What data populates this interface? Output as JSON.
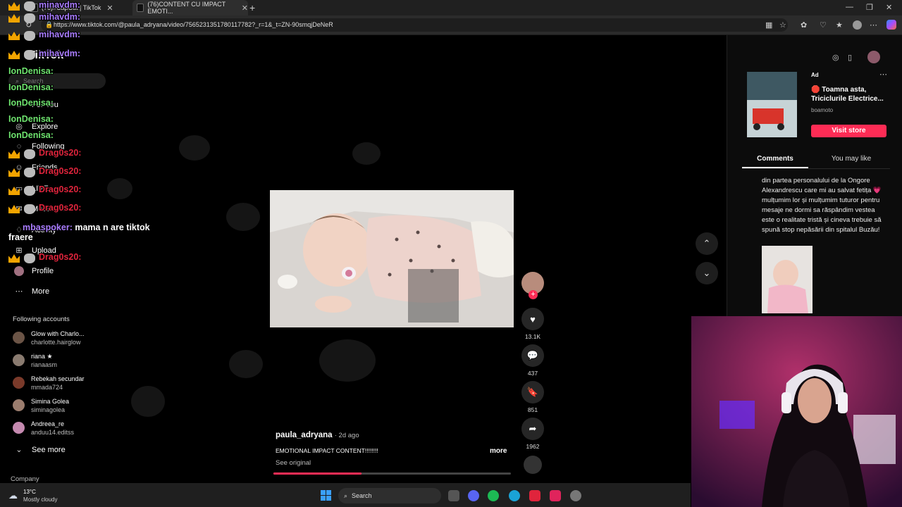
{
  "browser": {
    "tabs": [
      {
        "title": "(76)#CapCut | TikTok"
      },
      {
        "title": "(76)CONTENT CU IMPACT EMOTI..."
      }
    ],
    "url": "https://www.tiktok.com/@paula_adryana/video/7565231351780117782?_r=1&_t=ZN-90smqjDeNeR"
  },
  "sidebar": {
    "logo": "TikTok",
    "search_placeholder": "Search",
    "nav": [
      {
        "label": "For You",
        "icon": "home-icon"
      },
      {
        "label": "Explore",
        "icon": "compass-icon"
      },
      {
        "label": "Following",
        "icon": "following-icon"
      },
      {
        "label": "Friends",
        "icon": "friends-icon"
      },
      {
        "label": "LIVE",
        "icon": "live-icon"
      },
      {
        "label": "Messages",
        "icon": "messages-icon"
      },
      {
        "label": "Activity",
        "icon": "activity-icon"
      },
      {
        "label": "Upload",
        "icon": "upload-icon"
      },
      {
        "label": "Profile",
        "icon": "profile-icon"
      },
      {
        "label": "More",
        "icon": "more-icon"
      }
    ],
    "following_title": "Following accounts",
    "accounts": [
      {
        "name": "Glow with Charlo...",
        "handle": "charlotte.hairglow",
        "color": "#6b5446"
      },
      {
        "name": "riana ★",
        "handle": "rianaasm",
        "color": "#8a7b70"
      },
      {
        "name": "Rebekah secundar",
        "handle": "mmada724",
        "color": "#7a3a2a"
      },
      {
        "name": "Simina Golea",
        "handle": "siminagolea",
        "color": "#9b7d6e"
      },
      {
        "name": "Andreea_re",
        "handle": "anduu14.editss",
        "color": "#c58ab0"
      }
    ],
    "see_more": "See more",
    "company": "Company"
  },
  "chat": [
    {
      "user": "minavdm:",
      "color": "#a97cff",
      "msg": "",
      "badge": true
    },
    {
      "user": "mihavdm:",
      "color": "#a97cff",
      "msg": "",
      "badge": true
    },
    {
      "user": "mihavdm:",
      "color": "#a97cff",
      "msg": "",
      "badge": true
    },
    {
      "user": "mihavdm:",
      "color": "#a97cff",
      "msg": "",
      "badge": true
    },
    {
      "user": "IonDenisa:",
      "color": "#6ee36e",
      "msg": "",
      "badge": false
    },
    {
      "user": "IonDenisa:",
      "color": "#6ee36e",
      "msg": "",
      "badge": false
    },
    {
      "user": "IonDenisa:",
      "color": "#6ee36e",
      "msg": "",
      "badge": false
    },
    {
      "user": "IonDenisa:",
      "color": "#6ee36e",
      "msg": "",
      "badge": false
    },
    {
      "user": "IonDenisa:",
      "color": "#6ee36e",
      "msg": "",
      "badge": false
    },
    {
      "user": "Drag0s20:",
      "color": "#e0243c",
      "msg": "",
      "badge": true
    },
    {
      "user": "Drag0s20:",
      "color": "#e0243c",
      "msg": "",
      "badge": true
    },
    {
      "user": "Drag0s20:",
      "color": "#e0243c",
      "msg": "",
      "badge": true
    },
    {
      "user": "Drag0s20:",
      "color": "#e0243c",
      "msg": "",
      "badge": true
    },
    {
      "user": "mbaspoker:",
      "color": "#a97cff",
      "msg": "mama n are tiktok fraere",
      "badge": false
    },
    {
      "user": "Drag0s20:",
      "color": "#e0243c",
      "msg": "",
      "badge": true
    }
  ],
  "video": {
    "author": "paula_adryana",
    "time": "· 2d ago",
    "caption": "EMOTIONAL IMPACT CONTENT!!!!!!!!",
    "more": "more",
    "see_original": "See original",
    "progress": 0.37,
    "likes": "13.1K",
    "comments": "437",
    "saves": "851",
    "shares": "1962"
  },
  "ad": {
    "label": "Ad",
    "title": "🛑 Toamna asta, Triciclurile Electrice...",
    "advertiser": "boamoto",
    "cta": "Visit store"
  },
  "panel_tabs": {
    "comments": "Comments",
    "like": "You may like"
  },
  "comment_text": "din partea personalului de la Ongore Alexandrescu care mi au salvat fetița 💗 mulțumim lor și mulțumim tuturor pentru mesaje ne dormi sa răspândim vestea este o realitate tristă și cineva trebuie să spună stop nepăsării din spitalul Buzău!",
  "taskbar": {
    "weather_temp": "13°C",
    "weather_desc": "Mostly cloudy",
    "search": "Search"
  },
  "colors": {
    "accent": "#fe2c55",
    "chat_crown": "#f2a400"
  }
}
